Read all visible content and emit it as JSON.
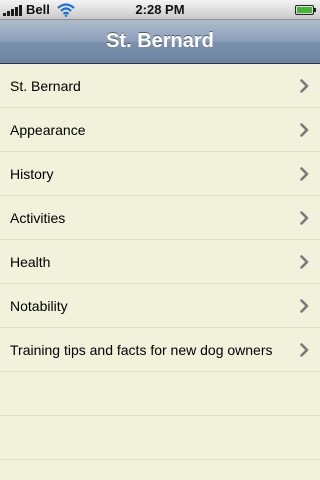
{
  "status_bar": {
    "carrier": "Bell",
    "time": "2:28 PM",
    "signal_bars": 5,
    "battery_level": 1.0
  },
  "nav_bar": {
    "title": "St. Bernard"
  },
  "list": {
    "items": [
      {
        "label": "St. Bernard"
      },
      {
        "label": "Appearance"
      },
      {
        "label": "History"
      },
      {
        "label": "Activities"
      },
      {
        "label": "Health"
      },
      {
        "label": "Notability"
      },
      {
        "label": "Training tips and facts for new dog owners"
      }
    ],
    "accessory_icon": "chevron-right-icon"
  },
  "colors": {
    "background": "#f1f1dc",
    "nav_bar": "#8c9fb9",
    "separator": "#dcdcc8",
    "chevron": "#7a7a7a"
  }
}
